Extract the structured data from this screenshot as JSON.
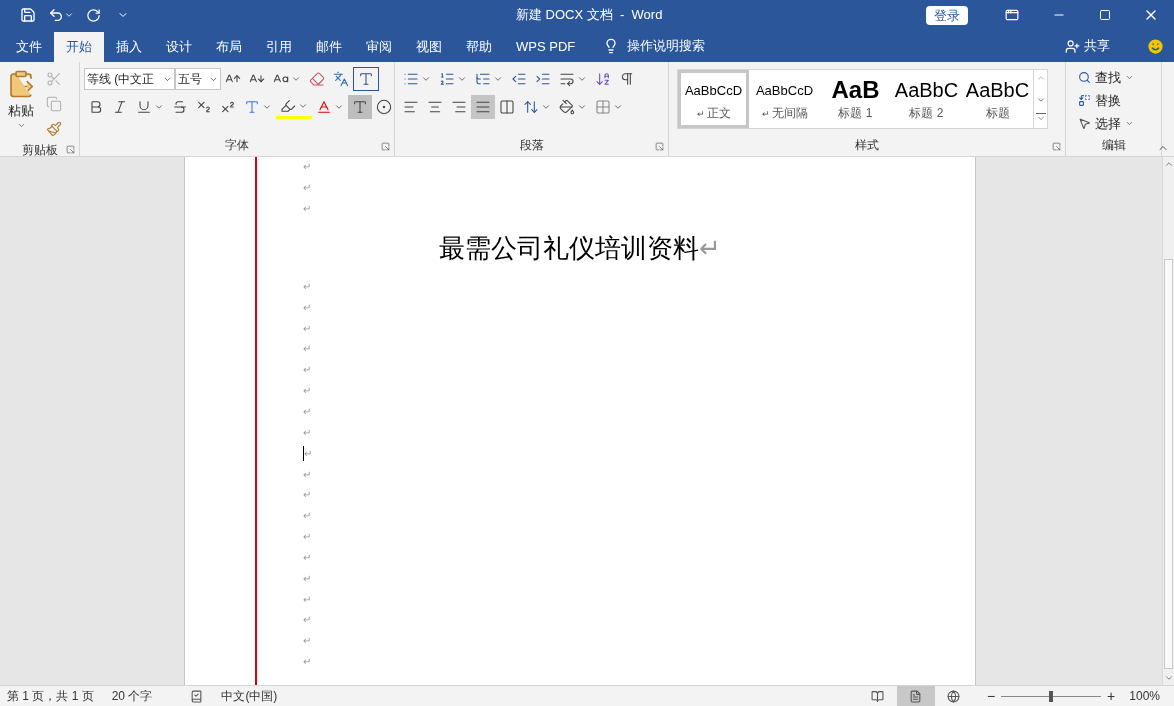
{
  "window": {
    "title": "新建 DOCX 文档  -  Word",
    "sign_in": "登录"
  },
  "tabs": [
    {
      "label": "文件",
      "selected": false
    },
    {
      "label": "开始",
      "selected": true
    },
    {
      "label": "插入",
      "selected": false
    },
    {
      "label": "设计",
      "selected": false
    },
    {
      "label": "布局",
      "selected": false
    },
    {
      "label": "引用",
      "selected": false
    },
    {
      "label": "邮件",
      "selected": false
    },
    {
      "label": "审阅",
      "selected": false
    },
    {
      "label": "视图",
      "selected": false
    },
    {
      "label": "帮助",
      "selected": false
    },
    {
      "label": "WPS PDF",
      "selected": false
    }
  ],
  "tell_me": "操作说明搜索",
  "share": "共享",
  "clipboard": {
    "paste": "粘贴",
    "label": "剪贴板",
    "tools": [
      {
        "kind": "cut",
        "disabled": true
      },
      {
        "kind": "copy",
        "disabled": true
      },
      {
        "kind": "format_painter",
        "disabled": false
      }
    ]
  },
  "font": {
    "label": "字体",
    "font_name": "等线 (中文正",
    "font_size": "五号"
  },
  "paragraph": {
    "label": "段落",
    "alignment": [
      {
        "kind": "left",
        "selected": false
      },
      {
        "kind": "center",
        "selected": false
      },
      {
        "kind": "right",
        "selected": false
      },
      {
        "kind": "justify",
        "selected": true
      },
      {
        "kind": "distributed",
        "selected": false
      }
    ]
  },
  "styles": {
    "label": "样式",
    "items": [
      {
        "kind": "normal",
        "preview": "AaBbCcD",
        "name": "正文",
        "mark": "↵",
        "selected": true
      },
      {
        "kind": "normal",
        "preview": "AaBbCcD",
        "name": "无间隔",
        "mark": "↵",
        "selected": false
      },
      {
        "kind": "heading1",
        "preview": "AaB",
        "name": "标题 1",
        "selected": false
      },
      {
        "kind": "heading2",
        "preview": "AaBbC",
        "name": "标题 2",
        "selected": false
      },
      {
        "kind": "title",
        "preview": "AaBbC",
        "name": "标题",
        "selected": false
      }
    ]
  },
  "editing": {
    "label": "编辑",
    "find": "查找",
    "replace": "替换",
    "select": "选择"
  },
  "document": {
    "paragraphs": [
      {
        "kind": "empty",
        "mark": "↵",
        "cursor": false
      },
      {
        "kind": "empty",
        "mark": "↵",
        "cursor": false
      },
      {
        "kind": "empty",
        "mark": "↵",
        "cursor": false
      },
      {
        "kind": "title",
        "text": "最需公司礼仪培训资料",
        "mark": "↵",
        "cursor": false
      },
      {
        "kind": "empty",
        "mark": "↵",
        "cursor": false
      },
      {
        "kind": "empty",
        "mark": "↵",
        "cursor": false
      },
      {
        "kind": "empty",
        "mark": "↵",
        "cursor": false
      },
      {
        "kind": "empty",
        "mark": "↵",
        "cursor": false
      },
      {
        "kind": "empty",
        "mark": "↵",
        "cursor": false
      },
      {
        "kind": "empty",
        "mark": "↵",
        "cursor": false
      },
      {
        "kind": "empty",
        "mark": "↵",
        "cursor": false
      },
      {
        "kind": "empty",
        "mark": "↵",
        "cursor": false
      },
      {
        "kind": "empty",
        "mark": "↵",
        "cursor": true
      },
      {
        "kind": "empty",
        "mark": "↵",
        "cursor": false
      },
      {
        "kind": "empty",
        "mark": "↵",
        "cursor": false
      },
      {
        "kind": "empty",
        "mark": "↵",
        "cursor": false
      },
      {
        "kind": "empty",
        "mark": "↵",
        "cursor": false
      },
      {
        "kind": "empty",
        "mark": "↵",
        "cursor": false
      },
      {
        "kind": "empty",
        "mark": "↵",
        "cursor": false
      },
      {
        "kind": "empty",
        "mark": "↵",
        "cursor": false
      },
      {
        "kind": "empty",
        "mark": "↵",
        "cursor": false
      },
      {
        "kind": "empty",
        "mark": "↵",
        "cursor": false
      },
      {
        "kind": "empty",
        "mark": "↵",
        "cursor": false
      }
    ]
  },
  "status_bar": {
    "page": "第 1 页，共 1 页",
    "words": "20 个字",
    "language": "中文(中国)",
    "views": [
      {
        "kind": "read",
        "selected": false
      },
      {
        "kind": "print",
        "selected": true
      },
      {
        "kind": "web",
        "selected": false
      }
    ],
    "zoom_out": "−",
    "zoom_in": "+",
    "zoom": {
      "level": 0.5
    },
    "zoom_percent": "100%"
  }
}
